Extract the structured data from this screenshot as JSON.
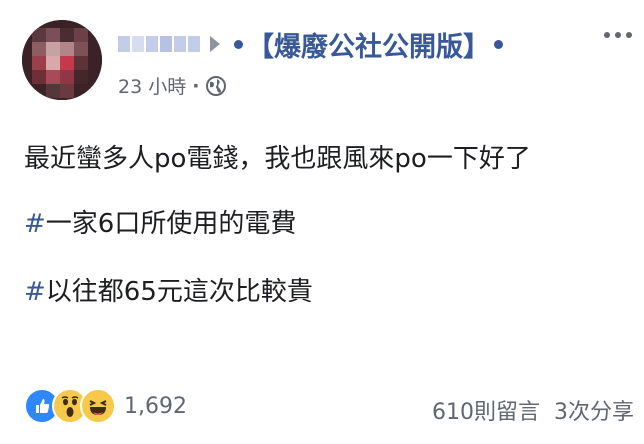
{
  "post": {
    "group_name": "【爆廢公社公開版】",
    "timestamp": "23 小時",
    "meta_separator": "·",
    "privacy_icon": "globe-icon",
    "lines": {
      "line1": "最近蠻多人po電錢，我也跟風來po一下好了",
      "line2_hash": "#",
      "line2_text": "一家6口所使用的電費",
      "line3_hash": "#",
      "line3_text": "以往都65元這次比較貴"
    }
  },
  "reactions": {
    "icons": [
      "like-icon",
      "wow-icon",
      "haha-icon"
    ],
    "count": "1,692"
  },
  "stats": {
    "comments": "610則留言",
    "shares": "3次分享"
  },
  "colors": {
    "link": "#385898",
    "text": "#1c1e21",
    "meta": "#616770",
    "like": "#2d88ff",
    "emoji": "#f7c94a"
  }
}
